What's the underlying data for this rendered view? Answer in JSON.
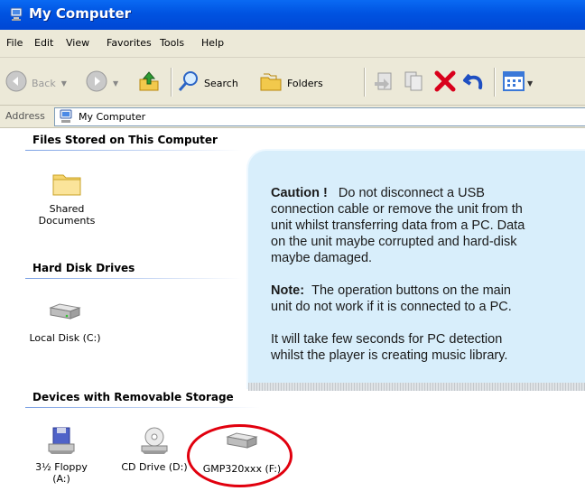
{
  "window": {
    "title": "My Computer"
  },
  "menubar": {
    "items": [
      "File",
      "Edit",
      "View",
      "Favorites",
      "Tools",
      "Help"
    ]
  },
  "toolbar": {
    "back_label": "Back",
    "search_label": "Search",
    "folders_label": "Folders"
  },
  "address": {
    "label": "Address",
    "value": "My Computer"
  },
  "groups": {
    "files_stored": {
      "header": "Files Stored on This Computer",
      "items": [
        {
          "label_line1": "Shared",
          "label_line2": "Documents",
          "icon": "folder-icon"
        }
      ]
    },
    "hard_disks": {
      "header": "Hard Disk Drives",
      "items": [
        {
          "label": "Local Disk (C:)",
          "icon": "hard-disk-icon"
        }
      ]
    },
    "removable": {
      "header": "Devices with Removable Storage",
      "items": [
        {
          "label_line1": "3½ Floppy",
          "label_line2": "(A:)",
          "icon": "floppy-drive-icon"
        },
        {
          "label": "CD Drive (D:)",
          "icon": "cd-drive-icon"
        },
        {
          "label": "GMP320xxx (F:)",
          "icon": "removable-disk-icon"
        }
      ]
    }
  },
  "callout": {
    "caution_title": "Caution !",
    "caution_lines": [
      "Do not disconnect a USB",
      "connection cable or remove the unit from th",
      "unit whilst transferring data from a PC. Data",
      "on the unit maybe corrupted and hard-disk",
      "maybe damaged."
    ],
    "note_title": "Note:",
    "note_lines": [
      "The operation buttons on the main",
      "unit do not work if it is connected to a PC."
    ],
    "info_lines": [
      "It will take few seconds for PC detection",
      "whilst the player is creating music library."
    ]
  },
  "colors": {
    "titlebar": "#0053e1",
    "chrome": "#ece9d8",
    "callout_bg": "#d8eefb",
    "highlight_ring": "#e1000e"
  }
}
